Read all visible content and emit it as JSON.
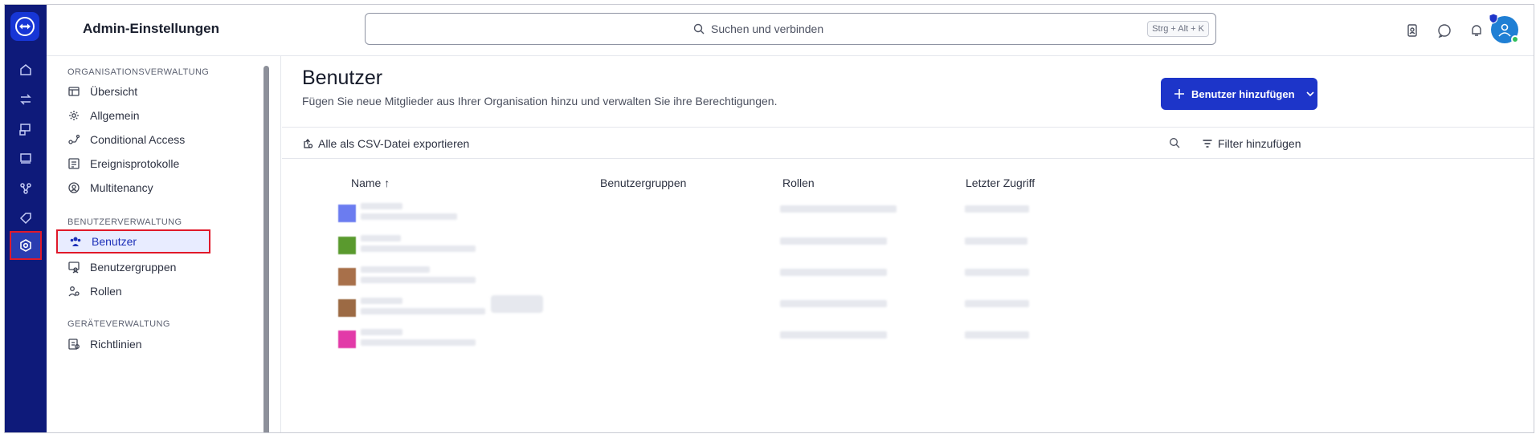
{
  "header": {
    "title": "Admin-Einstellungen",
    "search_placeholder": "Suchen und verbinden",
    "search_shortcut": "Strg + Alt + K"
  },
  "sidebar": {
    "sections": [
      {
        "heading": "ORGANISATIONSVERWALTUNG",
        "items": [
          {
            "label": "Übersicht",
            "icon": "overview-icon"
          },
          {
            "label": "Allgemein",
            "icon": "gear-icon"
          },
          {
            "label": "Conditional Access",
            "icon": "conditional-access-icon"
          },
          {
            "label": "Ereignisprotokolle",
            "icon": "event-log-icon"
          },
          {
            "label": "Multitenancy",
            "icon": "multitenancy-icon"
          }
        ]
      },
      {
        "heading": "BENUTZERVERWALTUNG",
        "items": [
          {
            "label": "Benutzer",
            "icon": "users-icon",
            "active": true
          },
          {
            "label": "Benutzergruppen",
            "icon": "user-groups-icon"
          },
          {
            "label": "Rollen",
            "icon": "roles-icon"
          }
        ]
      },
      {
        "heading": "GERÄTEVERWALTUNG",
        "items": [
          {
            "label": "Richtlinien",
            "icon": "policies-icon"
          }
        ]
      }
    ]
  },
  "main": {
    "title": "Benutzer",
    "subtitle": "Fügen Sie neue Mitglieder aus Ihrer Organisation hinzu und verwalten Sie ihre Berechtigungen.",
    "add_button_label": "Benutzer hinzufügen",
    "export_label": "Alle als CSV-Datei exportieren",
    "filter_label": "Filter hinzufügen",
    "columns": [
      "Name ↑",
      "Benutzergruppen",
      "Rollen",
      "Letzter Zugriff"
    ],
    "rows": [
      {
        "avatar_color": "#6b7cf0"
      },
      {
        "avatar_color": "#5a9a2e"
      },
      {
        "avatar_color": "#a8704a"
      },
      {
        "avatar_color": "#9c6a44"
      },
      {
        "avatar_color": "#e23aa8"
      }
    ]
  },
  "colors": {
    "rail": "#0e1a7a",
    "accent": "#1d35c9",
    "highlight": "#e0192a"
  }
}
